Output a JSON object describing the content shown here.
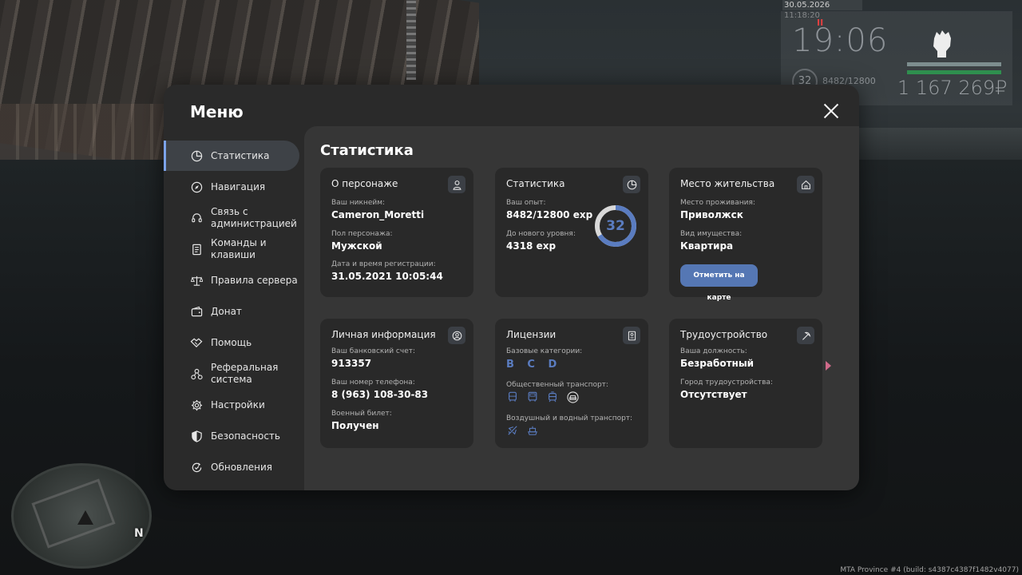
{
  "hud": {
    "date": "30.05.2026 11:18:20",
    "time": "19:06",
    "red_mark": "II",
    "level": "32",
    "exp": "8482/12800",
    "money": "1 167 269₽"
  },
  "menu": {
    "title": "Меню",
    "sidebar": [
      {
        "label": "Статистика",
        "icon": "pie-chart-icon",
        "active": true
      },
      {
        "label": "Навигация",
        "icon": "compass-icon"
      },
      {
        "label": "Связь с администрацией",
        "icon": "headset-icon"
      },
      {
        "label": "Команды и клавиши",
        "icon": "document-icon"
      },
      {
        "label": "Правила сервера",
        "icon": "scales-icon"
      },
      {
        "label": "Донат",
        "icon": "wallet-icon"
      },
      {
        "label": "Помощь",
        "icon": "handshake-icon"
      },
      {
        "label": "Реферальная система",
        "icon": "network-icon"
      },
      {
        "label": "Настройки",
        "icon": "gear-icon"
      },
      {
        "label": "Безопасность",
        "icon": "shield-icon"
      },
      {
        "label": "Обновления",
        "icon": "refresh-check-icon"
      }
    ],
    "content_title": "Статистика",
    "cards": {
      "character": {
        "title": "О персонаже",
        "nickname_label": "Ваш никнейм:",
        "nickname": "Cameron_Moretti",
        "gender_label": "Пол персонажа:",
        "gender": "Мужской",
        "reg_label": "Дата и время регистрации:",
        "reg": "31.05.2021 10:05:44"
      },
      "stats": {
        "title": "Статистика",
        "exp_label": "Ваш опыт:",
        "exp": "8482/12800 exp",
        "next_label": "До нового уровня:",
        "next": "4318 exp",
        "level": "32",
        "progress": 0.6627
      },
      "residence": {
        "title": "Место жительства",
        "city_label": "Место проживания:",
        "city": "Приволжск",
        "property_label": "Вид имущества:",
        "property": "Квартира",
        "button": "Отметить на карте"
      },
      "personal": {
        "title": "Личная информация",
        "bank_label": "Ваш банковский счет:",
        "bank": "913357",
        "phone_label": "Ваш номер телефона:",
        "phone": "8 (963) 108-30-83",
        "military_label": "Военный билет:",
        "military": "Получен"
      },
      "licenses": {
        "title": "Лицензии",
        "base_label": "Базовые категории:",
        "base": "B C D",
        "public_label": "Общественный транспорт:",
        "air_label": "Воздушный и водный транспорт:"
      },
      "job": {
        "title": "Трудоустройство",
        "position_label": "Ваша должность:",
        "position": "Безработный",
        "city_label": "Город трудоустройства:",
        "city": "Отсутствует"
      }
    }
  },
  "build_info": "MTA Province #4 (build: s4387c4387f1482v4077)",
  "colors": {
    "accent": "#5a7cc0",
    "button": "#5577b4",
    "active_bar": "#7ca3ea"
  }
}
